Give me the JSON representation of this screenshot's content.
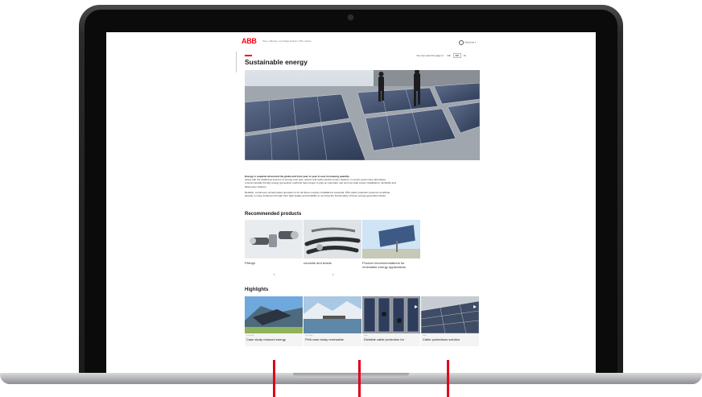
{
  "site": {
    "logo": "ABB",
    "breadcrumb": "Home › Offerings › Low Voltage Products › PHA › Industri",
    "region": "Global site ▾",
    "view_in_label": "You can view this page in:",
    "languages": [
      {
        "code": "DE",
        "active": false
      },
      {
        "code": "EN",
        "active": true
      },
      {
        "code": "FL",
        "active": false
      }
    ],
    "page_title": "Sustainable energy",
    "intro": {
      "lead": "Energy is required all around the globe and from year to year in ever increasing quantity.",
      "p1": "Along with the traditional sources of energy coal, gas, atomic and hydro-electric power stations, in recent years many alternative, environmentally friendly energy generation methods have begun to play an important role such as solar power installations, windmills and tidal power stations.",
      "p2": "Reliable, continuous uninterrupted operation is for all these complex installations essential. PHA cable protection systems contribute already in many instances through their high quality and durability to securing the functionality of these energy generation plants."
    },
    "recommended_heading": "Recommended products",
    "recommended": [
      {
        "title": "Fittings"
      },
      {
        "title": "conduits and braids"
      },
      {
        "title": "Product recommendations for renewable energy applications"
      }
    ],
    "highlights_heading": "Highlights",
    "highlights": [
      {
        "category": "Case Study",
        "title": "Case study reduced energy"
      },
      {
        "category": "Case Study",
        "title": "PHA case study renewable"
      },
      {
        "category": "Video",
        "title": "Divisible cable protection for"
      },
      {
        "category": "Video",
        "title": "Cable protections solution"
      }
    ]
  },
  "colors": {
    "brand_red": "#ff000f",
    "annotation_red": "#e0001a",
    "laptop_dark": "#1b1b1d"
  }
}
